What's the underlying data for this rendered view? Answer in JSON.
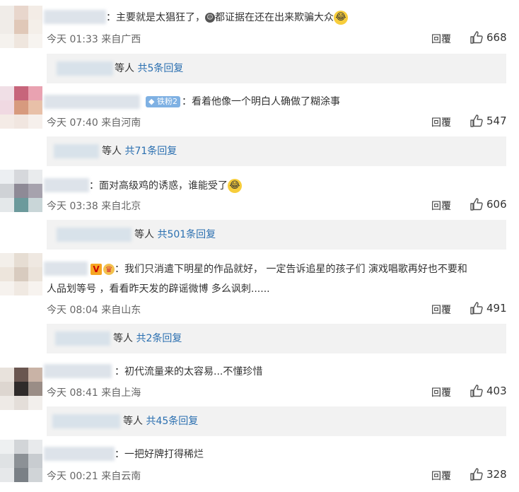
{
  "labels": {
    "reply": "回覆",
    "others": "等人"
  },
  "comments": [
    {
      "text": "：主要就是太猖狂了，",
      "text2": "都证据在还在出来欺骗大众",
      "meta": "今天 01:33 来自广西",
      "likes": "668",
      "replies": "共5条回复"
    },
    {
      "fan_badge": "铁粉2",
      "text": "：看着他像一个明白人确做了糊涂事",
      "meta": "今天 07:40 来自河南",
      "likes": "547",
      "replies": "共71条回复"
    },
    {
      "text": "：面对高级鸡的诱惑，谁能受了",
      "meta": "今天 03:38 来自北京",
      "likes": "606",
      "replies": "共501条回复"
    },
    {
      "text": "：我们只消遣下明星的作品就好，  一定告诉追星的孩子们 演戏唱歌再好也不要和",
      "text2": "人品划等号 ，看看昨天发的辟谣微博 多么讽刺......",
      "meta": "今天 08:04 来自山东",
      "likes": "491",
      "replies": "共2条回复"
    },
    {
      "text": "：初代流量来的太容易...不懂珍惜",
      "meta": "今天 08:41 来自上海",
      "likes": "403",
      "replies": "共45条回复"
    },
    {
      "text": "：一把好牌打得稀烂",
      "meta": "今天 00:21 来自云南",
      "likes": "328"
    }
  ]
}
